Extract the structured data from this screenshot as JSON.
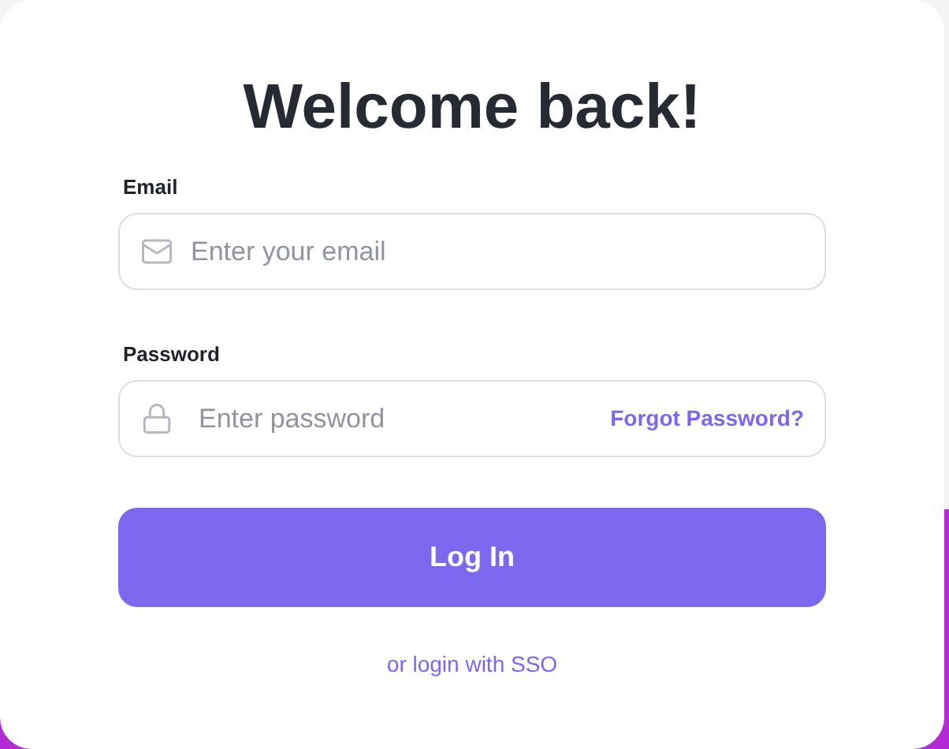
{
  "title": "Welcome back!",
  "email": {
    "label": "Email",
    "placeholder": "Enter your email"
  },
  "password": {
    "label": "Password",
    "placeholder": "Enter password",
    "forgot_link": "Forgot Password?"
  },
  "login_button": "Log In",
  "sso_link": "or login with SSO"
}
